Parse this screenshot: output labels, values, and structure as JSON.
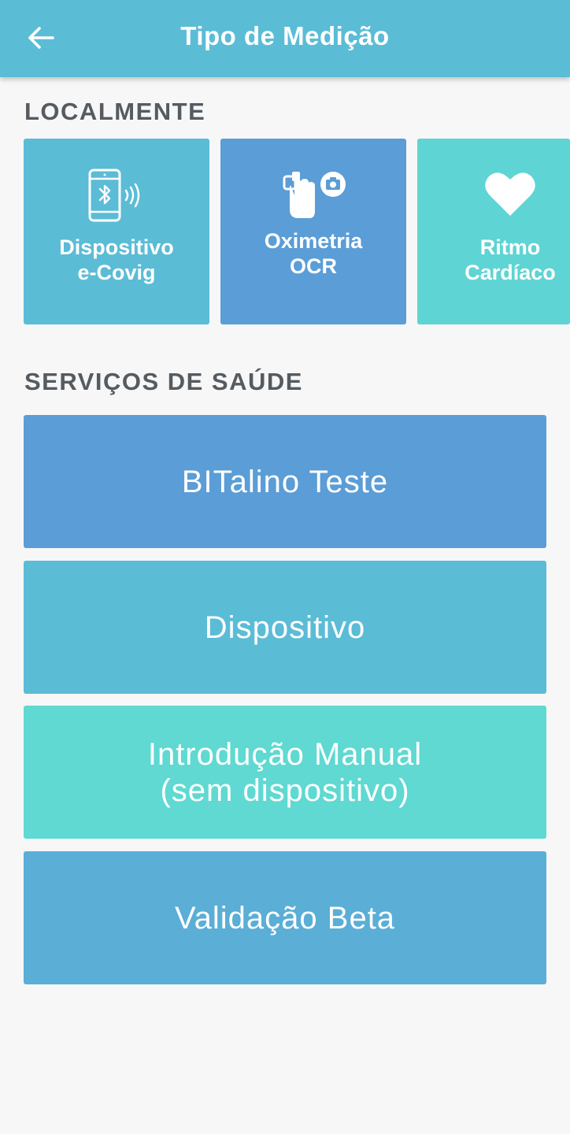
{
  "header": {
    "title": "Tipo de Medição",
    "back_icon": "arrow-left-icon"
  },
  "local": {
    "section_title": "LOCALMENTE",
    "tiles": [
      {
        "line1": "Dispositivo",
        "line2": "e-Covig",
        "icon": "phone-bluetooth-icon",
        "color": "#5bbcd6"
      },
      {
        "line1": "Oximetria",
        "line2": "OCR",
        "icon": "finger-oximeter-camera-icon",
        "color": "#5b9dd6"
      },
      {
        "line1": "Ritmo",
        "line2": "Cardíaco",
        "icon": "heart-icon",
        "color": "#5fd4d4"
      }
    ]
  },
  "health_services": {
    "section_title": "SERVIÇOS DE SAÚDE",
    "buttons": [
      {
        "line1": "BITalino Teste",
        "line2": "",
        "color": "#5b9dd6"
      },
      {
        "line1": "Dispositivo",
        "line2": "",
        "color": "#5bbcd6"
      },
      {
        "line1": "Introdução Manual",
        "line2": "(sem dispositivo)",
        "color": "#5fd9d2"
      },
      {
        "line1": "Validação Beta",
        "line2": "",
        "color": "#5baed6"
      }
    ]
  },
  "colors": {
    "appbar": "#5bbcd6",
    "background": "#f7f7f7",
    "section_text": "#555b60"
  }
}
